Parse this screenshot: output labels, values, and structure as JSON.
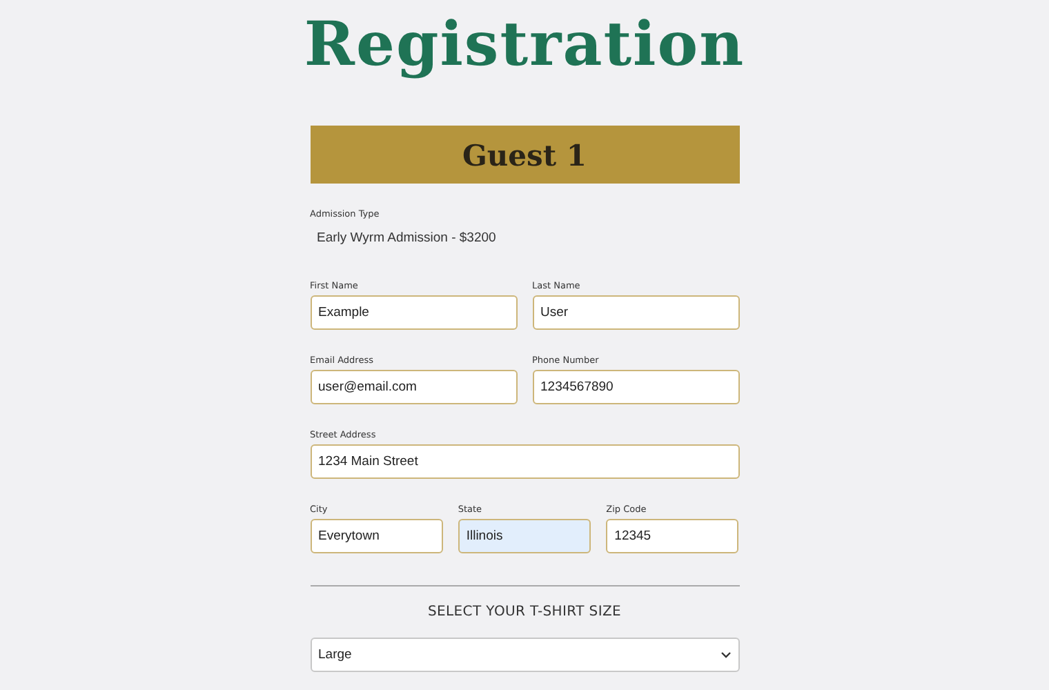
{
  "title": "Registration",
  "guest": {
    "heading": "Guest 1",
    "admission": {
      "label": "Admission Type",
      "value": "Early Wyrm Admission - $3200"
    },
    "rows": [
      [
        {
          "label": "First Name",
          "value": "Example",
          "autofilled": false
        },
        {
          "label": "Last Name",
          "value": "User",
          "autofilled": false
        }
      ],
      [
        {
          "label": "Email Address",
          "value": "user@email.com",
          "autofilled": false
        },
        {
          "label": "Phone Number",
          "value": "1234567890",
          "autofilled": false
        }
      ],
      [
        {
          "label": "Street Address",
          "value": "1234 Main Street",
          "autofilled": false
        }
      ],
      [
        {
          "label": "City",
          "value": "Everytown",
          "autofilled": false
        },
        {
          "label": "State",
          "value": "Illinois",
          "autofilled": true
        },
        {
          "label": "Zip Code",
          "value": "12345",
          "autofilled": false
        }
      ]
    ],
    "shirt": {
      "heading": "SELECT YOUR T-SHIRT SIZE",
      "value": "Large"
    }
  }
}
